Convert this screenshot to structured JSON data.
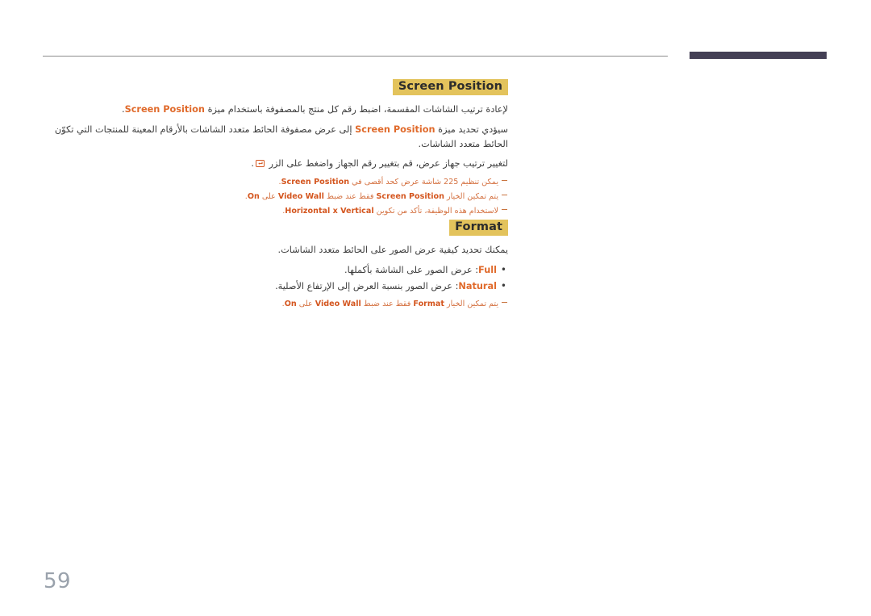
{
  "page": {
    "number": "59",
    "language": "ar",
    "direction": "rtl"
  },
  "colors": {
    "heading_highlight": "#e3c35c",
    "ui_term": "#e06a2b",
    "note_text": "#d4703f",
    "header_bar": "#444055",
    "header_rule": "#8d8d8d",
    "page_number": "#9aa2ac",
    "body_text": "#3c3c3c"
  },
  "sections": [
    {
      "id": "screen-position",
      "heading": "Screen Position",
      "paragraphs": [
        {
          "id": "sp-p1",
          "before": "لإعادة ترتيب الشاشات المقسمة، اضبط رقم كل منتج بالمصفوفة باستخدام ميزة ",
          "term": "Screen Position",
          "after": "."
        },
        {
          "id": "sp-p2",
          "before": "سيؤدي تحديد ميزة ",
          "term": "Screen Position",
          "after": " إلى عرض مصفوفة الحائط متعدد الشاشات بالأرقام المعينة للمنتجات التي تكوّن الحائط متعدد الشاشات."
        },
        {
          "id": "sp-p3",
          "before": "لتغيير ترتيب جهاز عرض، قم بتغيير رقم الجهاز واضغط على الزر ",
          "icon": "enter-key-icon",
          "after": "."
        }
      ],
      "notes": [
        {
          "id": "sp-n1",
          "before": "يمكن تنظيم 225 شاشة عرض كحد أقصى في ",
          "term": "Screen Position",
          "after": "."
        },
        {
          "id": "sp-n2",
          "before": "يتم تمكين الخيار ",
          "term": "Screen Position",
          "middle": " فقط عند ضبط ",
          "term2": "Video Wall",
          "middle2": " على ",
          "term3": "On",
          "after": "."
        },
        {
          "id": "sp-n3",
          "before": "لاستخدام هذه الوظيفة، تأكد من تكوين ",
          "term": "Horizontal x Vertical",
          "after": "."
        }
      ]
    },
    {
      "id": "format",
      "heading": "Format",
      "paragraphs": [
        {
          "id": "fmt-p1",
          "before": "يمكنك تحديد كيفية عرض الصور على الحائط متعدد الشاشات.",
          "term": "",
          "after": ""
        }
      ],
      "bullets": [
        {
          "id": "fmt-b1",
          "term": "Full",
          "text": ": عرض الصور على الشاشة بأكملها."
        },
        {
          "id": "fmt-b2",
          "term": "Natural",
          "text": ": عرض الصور بنسبة العرض إلى الإرتفاع الأصلية."
        }
      ],
      "notes": [
        {
          "id": "fmt-n1",
          "before": "يتم تمكين الخيار ",
          "term": "Format",
          "middle": " فقط عند ضبط ",
          "term2": "Video Wall",
          "middle2": " على ",
          "term3": "On",
          "after": "."
        }
      ]
    }
  ]
}
